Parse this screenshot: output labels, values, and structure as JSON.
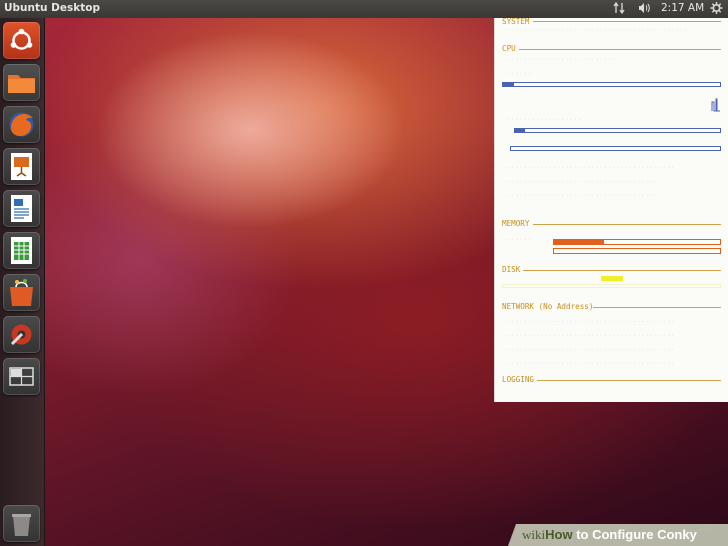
{
  "top_panel": {
    "title": "Ubuntu Desktop",
    "clock": "2:17 AM",
    "icons": [
      "network-icon",
      "volume-icon",
      "gear-icon"
    ]
  },
  "launcher": {
    "items": [
      {
        "name": "dash-home",
        "icon": "ubuntu-logo-icon",
        "color": "#c4411f"
      },
      {
        "name": "files",
        "icon": "folder-icon",
        "color": "#e0662a"
      },
      {
        "name": "firefox",
        "icon": "firefox-icon",
        "color": "#d9541f"
      },
      {
        "name": "impress",
        "icon": "presentation-icon",
        "color": "#d5691e"
      },
      {
        "name": "writer",
        "icon": "document-icon",
        "color": "#2f6fb5"
      },
      {
        "name": "calc",
        "icon": "spreadsheet-icon",
        "color": "#3b9a3b"
      },
      {
        "name": "software-center",
        "icon": "shopping-bag-icon",
        "color": "#d24a20"
      },
      {
        "name": "system-settings",
        "icon": "settings-icon",
        "color": "#c93622"
      },
      {
        "name": "workspaces",
        "icon": "workspace-switcher-icon",
        "color": "#4a4744"
      },
      {
        "name": "trash",
        "icon": "trash-icon",
        "color": "#6b6866"
      }
    ]
  },
  "conky": {
    "sections": {
      "system": "SYSTEM",
      "cpu": "CPU",
      "memory": "MEMORY",
      "disk": "DISK",
      "network": "NETWORK (No Address)",
      "logging": "LOGGING"
    },
    "bars": {
      "cpu_total": 0.05,
      "cpu_core1": 0.05,
      "cpu_core2": 0.0,
      "memory_ram": 0.3,
      "memory_swap": 0.0,
      "disk_usage": 0.0
    },
    "colors": {
      "accent": "#c8901c",
      "bar_blue": "#4b63b0",
      "bar_orange": "#e0601e",
      "bar_yellow": "#f1ef2a"
    }
  },
  "watermark": {
    "wiki": "wiki",
    "how": "How",
    "rest": " to Configure Conky"
  }
}
